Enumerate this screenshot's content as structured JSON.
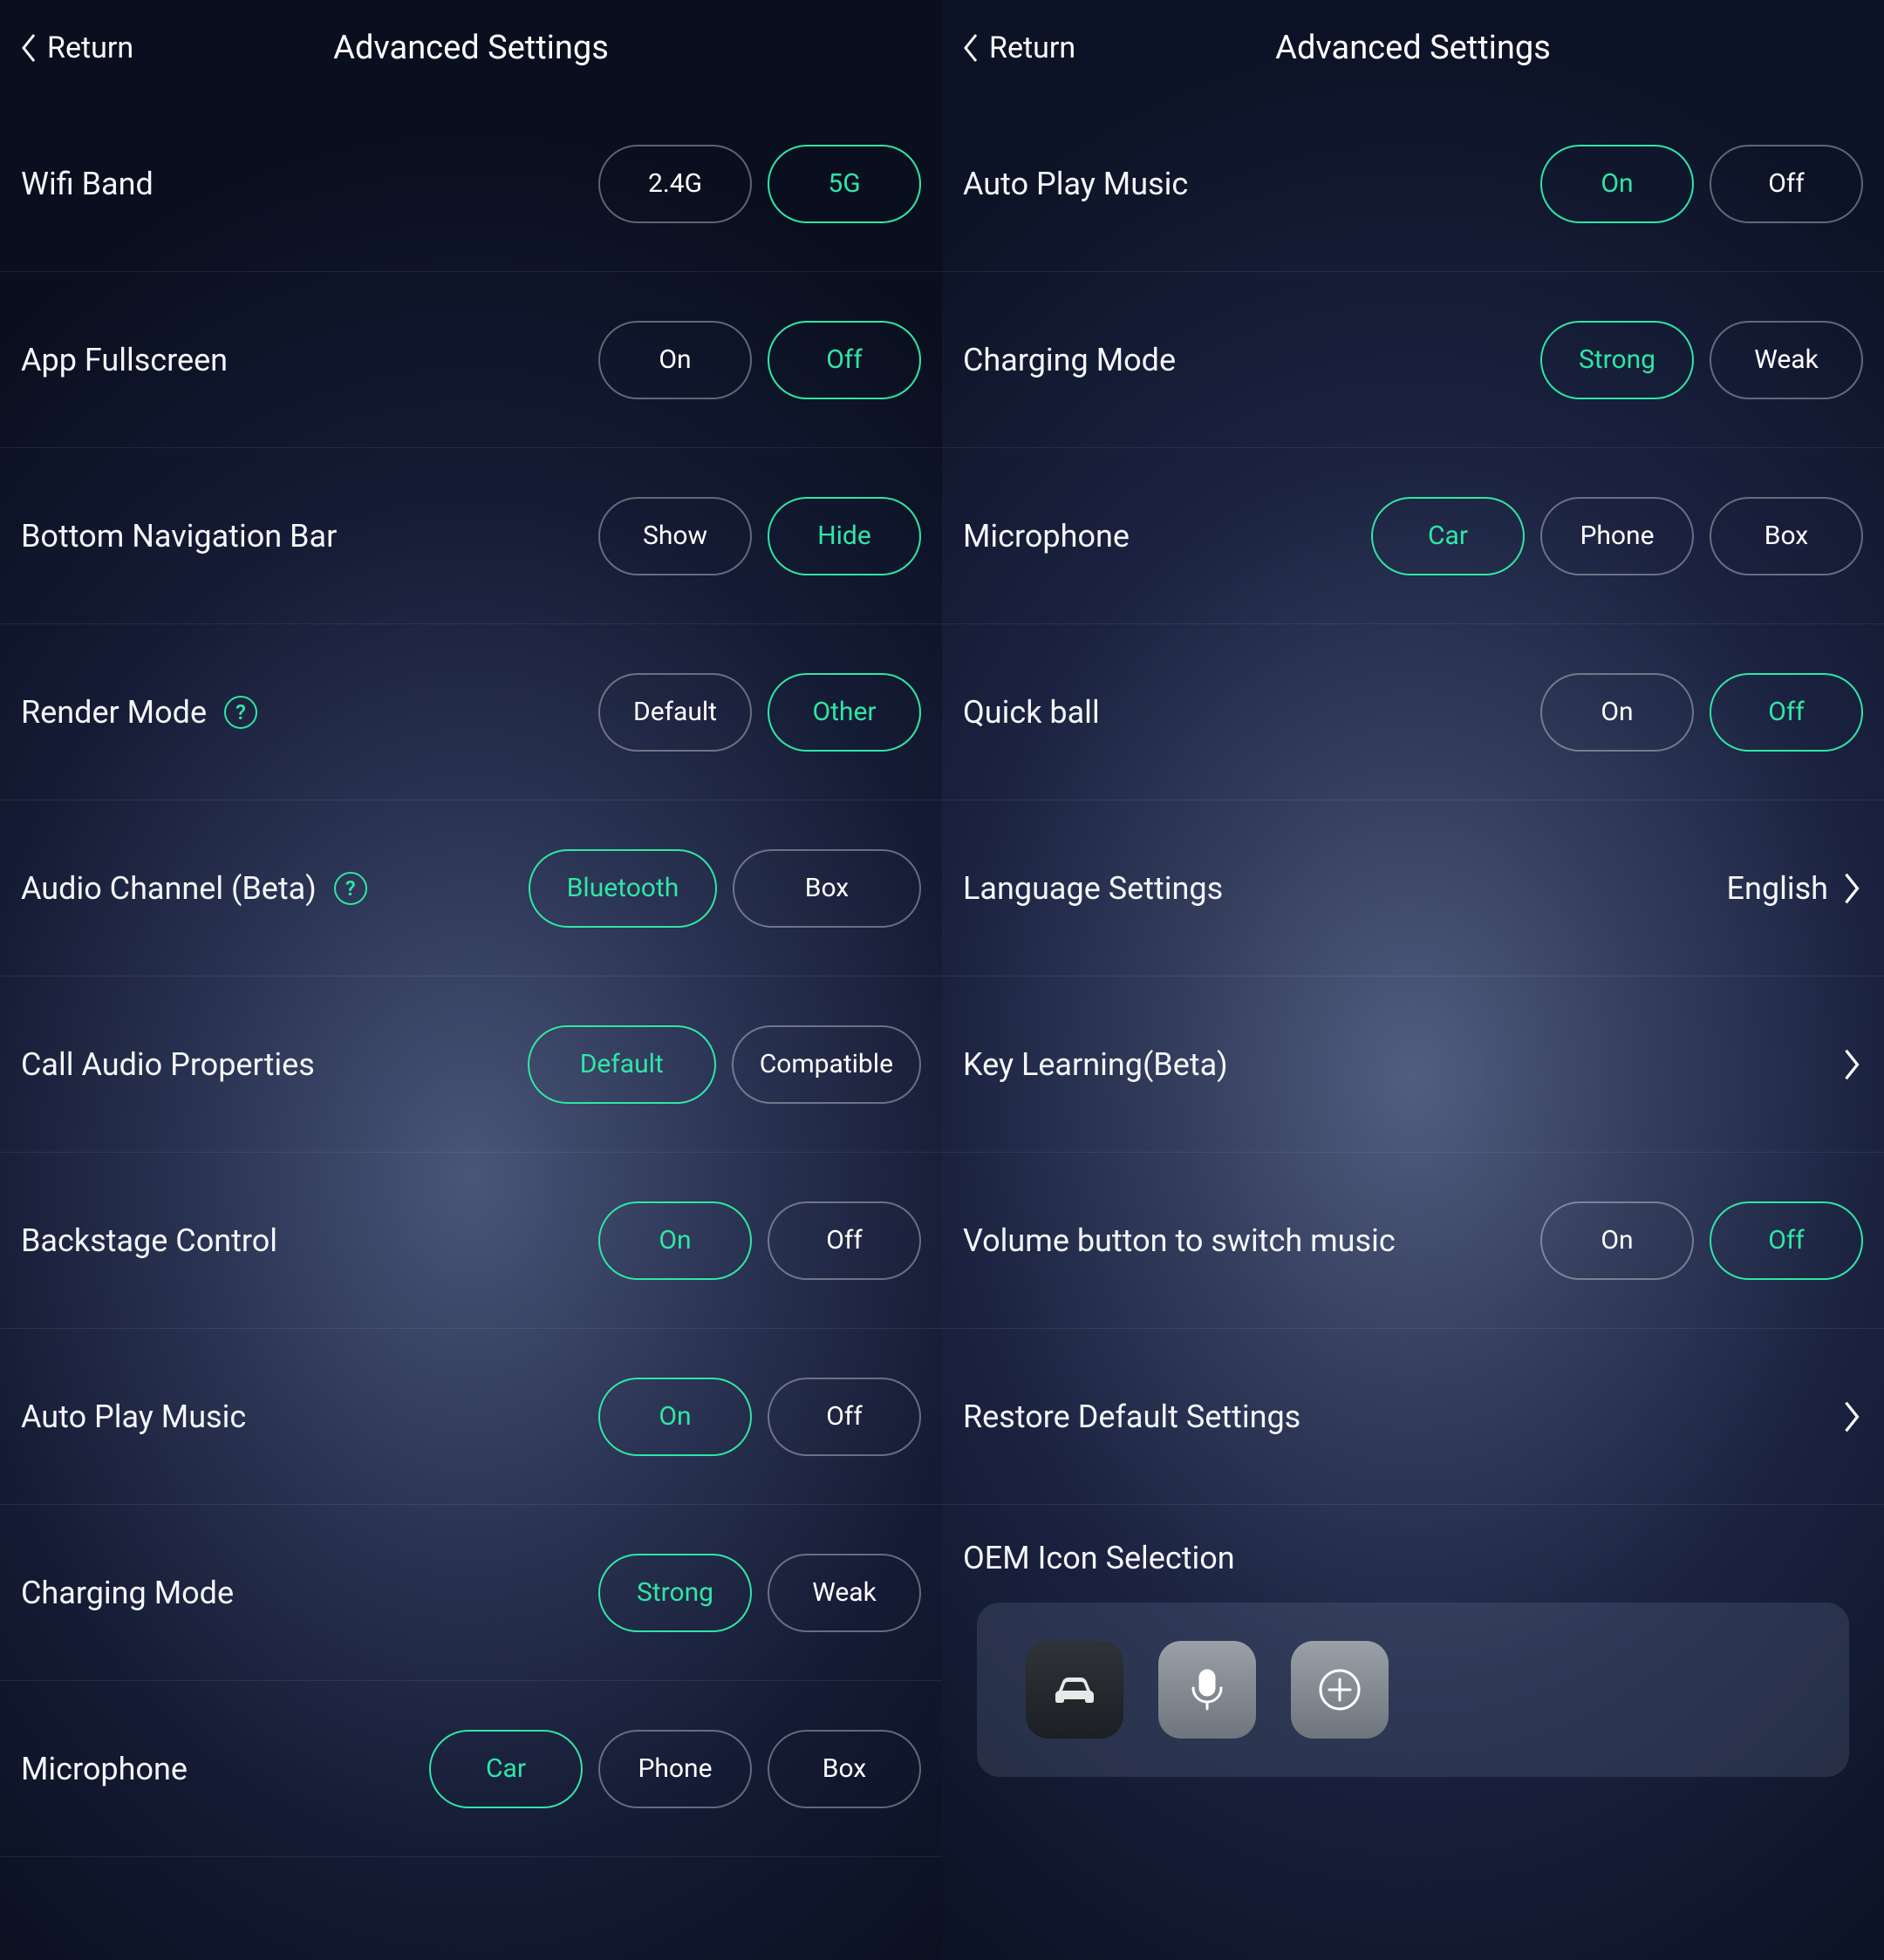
{
  "accent": "#2fe6a5",
  "left": {
    "return": "Return",
    "title": "Advanced Settings",
    "rows": [
      {
        "label": "Wifi Band",
        "options": [
          "2.4G",
          "5G"
        ],
        "active": 1
      },
      {
        "label": "App Fullscreen",
        "options": [
          "On",
          "Off"
        ],
        "active": 1
      },
      {
        "label": "Bottom Navigation Bar",
        "options": [
          "Show",
          "Hide"
        ],
        "active": 1
      },
      {
        "label": "Render Mode",
        "help": true,
        "options": [
          "Default",
          "Other"
        ],
        "active": 1
      },
      {
        "label": "Audio Channel (Beta)",
        "help": true,
        "optionsWide": true,
        "options": [
          "Bluetooth",
          "Box"
        ],
        "active": 0
      },
      {
        "label": "Call Audio Properties",
        "optionsWide": true,
        "options": [
          "Default",
          "Compatible"
        ],
        "active": 0
      },
      {
        "label": "Backstage Control",
        "options": [
          "On",
          "Off"
        ],
        "active": 0
      },
      {
        "label": "Auto Play Music",
        "options": [
          "On",
          "Off"
        ],
        "active": 0
      },
      {
        "label": "Charging Mode",
        "options": [
          "Strong",
          "Weak"
        ],
        "active": 0
      },
      {
        "label": "Microphone",
        "options": [
          "Car",
          "Phone",
          "Box"
        ],
        "active": 0
      }
    ]
  },
  "right": {
    "return": "Return",
    "title": "Advanced Settings",
    "rows": [
      {
        "label": "Auto Play Music",
        "options": [
          "On",
          "Off"
        ],
        "active": 0
      },
      {
        "label": "Charging Mode",
        "options": [
          "Strong",
          "Weak"
        ],
        "active": 0
      },
      {
        "label": "Microphone",
        "options": [
          "Car",
          "Phone",
          "Box"
        ],
        "active": 0
      },
      {
        "label": "Quick ball",
        "options": [
          "On",
          "Off"
        ],
        "active": 1
      }
    ],
    "language": {
      "label": "Language Settings",
      "value": "English"
    },
    "keyLearning": {
      "label": "Key Learning(Beta)"
    },
    "volumeSwitch": {
      "label": "Volume button to switch music",
      "options": [
        "On",
        "Off"
      ],
      "active": 1
    },
    "restore": {
      "label": "Restore Default Settings"
    },
    "oem": {
      "label": "OEM Icon Selection",
      "icons": [
        "car-icon",
        "mic-icon",
        "plus-icon"
      ]
    }
  }
}
